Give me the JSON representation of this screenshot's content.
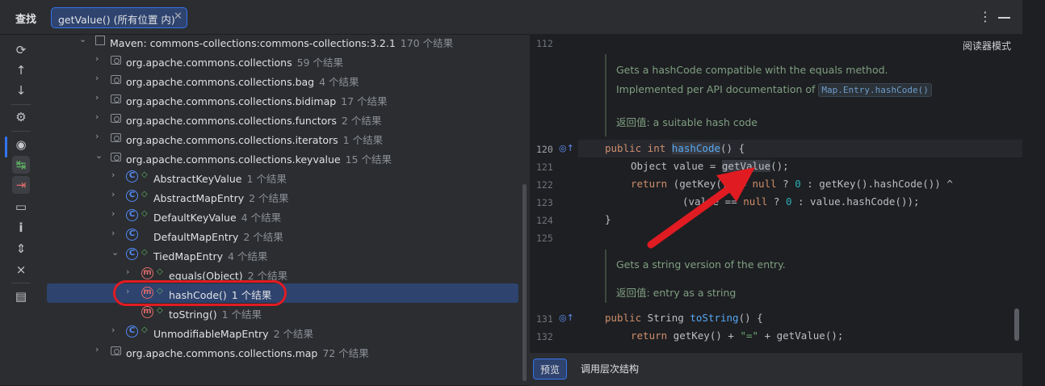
{
  "header": {
    "title": "查找",
    "tab_label": "getValue() (所有位置 内)",
    "close_glyph": "✕",
    "more_glyph": "⋮"
  },
  "toolbar": {
    "icons": [
      "refresh-icon",
      "arrow-up-icon",
      "arrow-down-icon",
      "settings-icon",
      "eye-icon",
      "navigate-icon",
      "exclude-icon",
      "folder-icon",
      "info-icon",
      "expand-icon",
      "collapse-icon",
      "preview-panel-icon"
    ]
  },
  "tree": {
    "rows": [
      {
        "label": "Maven: commons-collections:commons-collections:3.2.1",
        "count": "170 个结果"
      },
      {
        "label": "org.apache.commons.collections",
        "count": "59 个结果"
      },
      {
        "label": "org.apache.commons.collections.bag",
        "count": "4 个结果"
      },
      {
        "label": "org.apache.commons.collections.bidimap",
        "count": "17 个结果"
      },
      {
        "label": "org.apache.commons.collections.functors",
        "count": "2 个结果"
      },
      {
        "label": "org.apache.commons.collections.iterators",
        "count": "1 个结果"
      },
      {
        "label": "org.apache.commons.collections.keyvalue",
        "count": "15 个结果"
      },
      {
        "label": "AbstractKeyValue",
        "count": "1 个结果"
      },
      {
        "label": "AbstractMapEntry",
        "count": "2 个结果"
      },
      {
        "label": "DefaultKeyValue",
        "count": "4 个结果"
      },
      {
        "label": "DefaultMapEntry",
        "count": "2 个结果"
      },
      {
        "label": "TiedMapEntry",
        "count": "4 个结果"
      },
      {
        "label": "equals(Object)",
        "count": "2 个结果"
      },
      {
        "label": "hashCode()",
        "count": "1 个结果"
      },
      {
        "label": "toString()",
        "count": "1 个结果"
      },
      {
        "label": "UnmodifiableMapEntry",
        "count": "2 个结果"
      },
      {
        "label": "org.apache.commons.collections.map",
        "count": "72 个结果"
      }
    ]
  },
  "editor": {
    "reader_mode": "阅读器模式",
    "line_numbers": {
      "l112": "112",
      "l120": "120",
      "l121": "121",
      "l122": "122",
      "l123": "123",
      "l124": "124",
      "l125": "125",
      "l131": "131",
      "l132": "132"
    },
    "doc1": {
      "line1": "Gets a hashCode compatible with the equals method.",
      "line2": "Implemented per API documentation of",
      "code_ref": "Map.Entry.hashCode()",
      "returns": "返回值: a suitable hash code"
    },
    "doc2": {
      "line1": "Gets a string version of the entry.",
      "returns": "返回值: entry as a string"
    }
  },
  "bottom": {
    "preview": "预览",
    "call_hierarchy": "调用层次结构"
  },
  "colors": {
    "accent": "#3574f0",
    "annotation_red": "#e11b22"
  }
}
